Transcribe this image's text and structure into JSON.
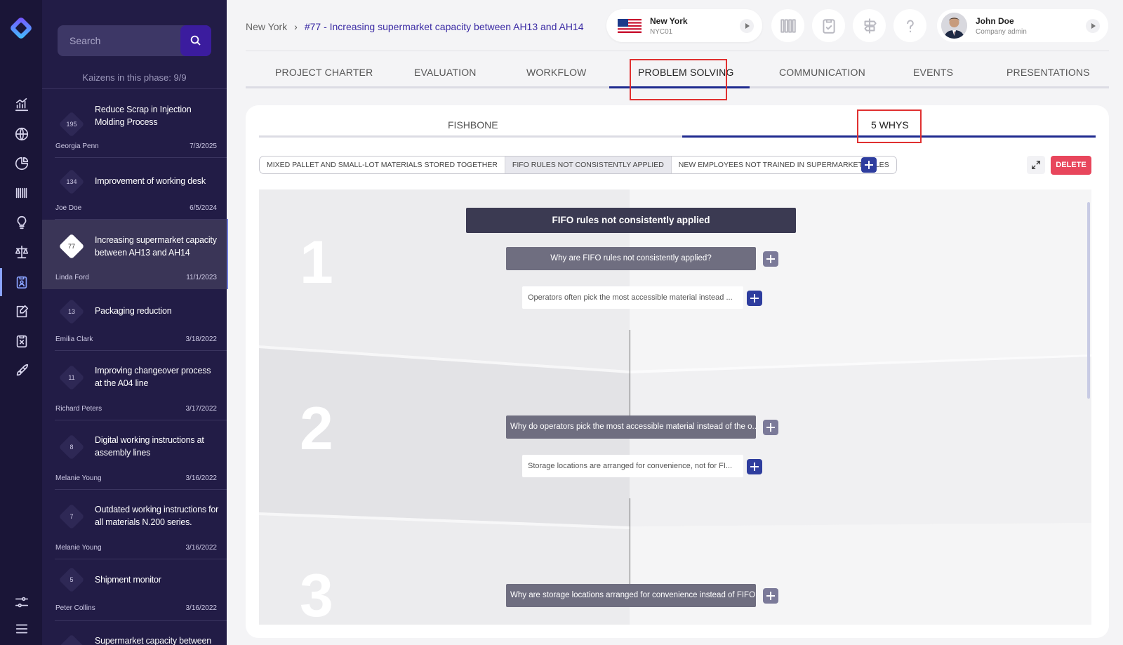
{
  "sidebar": {
    "icons": [
      "logo-icon",
      "chart-icon",
      "globe-icon",
      "pie-chart-icon",
      "barcode-icon",
      "lightbulb-icon",
      "balance-icon",
      "clipboard-person-icon",
      "edit-doc-icon",
      "clipboard-x-icon",
      "rocket-icon",
      "sliders-icon",
      "menu-icon"
    ]
  },
  "kaizen_panel": {
    "search_placeholder": "Search",
    "phase_count": "Kaizens in this phase: 9/9",
    "items": [
      {
        "num": "195",
        "title": "Reduce Scrap in Injection Molding Process",
        "owner": "Georgia Penn",
        "date": "7/3/2025"
      },
      {
        "num": "134",
        "title": "Improvement of working desk",
        "owner": "Joe Doe",
        "date": "6/5/2024"
      },
      {
        "num": "77",
        "title": "Increasing supermarket capacity between AH13 and AH14",
        "owner": "Linda Ford",
        "date": "11/1/2023"
      },
      {
        "num": "13",
        "title": "Packaging reduction",
        "owner": "Emilia Clark",
        "date": "3/18/2022"
      },
      {
        "num": "11",
        "title": "Improving changeover process at the A04 line",
        "owner": "Richard Peters",
        "date": "3/17/2022"
      },
      {
        "num": "8",
        "title": "Digital working instructions at assembly lines",
        "owner": "Melanie Young",
        "date": "3/16/2022"
      },
      {
        "num": "7",
        "title": "Outdated working instructions for all materials N.200 series.",
        "owner": "Melanie Young",
        "date": "3/16/2022"
      },
      {
        "num": "5",
        "title": "Shipment monitor",
        "owner": "Peter Collins",
        "date": "3/16/2022"
      },
      {
        "num": "",
        "title": "Supermarket capacity between",
        "owner": "",
        "date": ""
      }
    ]
  },
  "header": {
    "breadcrumb_root": "New York",
    "breadcrumb_current": "#77 - Increasing supermarket capacity between AH13 and AH14",
    "location": {
      "city": "New York",
      "code": "NYC01"
    },
    "user": {
      "name": "John Doe",
      "role": "Company admin"
    }
  },
  "tabs": [
    "PROJECT CHARTER",
    "EVALUATION",
    "WORKFLOW",
    "PROBLEM SOLVING",
    "COMMUNICATION",
    "EVENTS",
    "PRESENTATIONS"
  ],
  "active_tab": "PROBLEM SOLVING",
  "subtabs": [
    "FISHBONE",
    "5 WHYS"
  ],
  "active_subtab": "5 WHYS",
  "problems": [
    "MIXED PALLET AND SMALL-LOT MATERIALS STORED TOGETHER",
    "FIFO RULES NOT CONSISTENTLY APPLIED",
    "NEW EMPLOYEES NOT TRAINED IN SUPERMARKET RULES"
  ],
  "active_problem": "FIFO RULES NOT CONSISTENTLY APPLIED",
  "delete_label": "DELETE",
  "five_whys": {
    "root": "FIFO rules not consistently applied",
    "levels": [
      {
        "num": "1",
        "why": "Why are FIFO rules not consistently applied?",
        "answer": "Operators often pick the most accessible material instead ..."
      },
      {
        "num": "2",
        "why": "Why do operators pick the most accessible material instead of the o...",
        "answer": "Storage locations are arranged for convenience, not for FI..."
      },
      {
        "num": "3",
        "why": "Why are storage locations arranged for convenience instead of FIFO...",
        "answer": ""
      }
    ]
  },
  "colors": {
    "accent": "#1f2a8f",
    "danger": "#e8465c",
    "sidebar_bg": "#221c46",
    "rail_bg": "#1a1537"
  }
}
